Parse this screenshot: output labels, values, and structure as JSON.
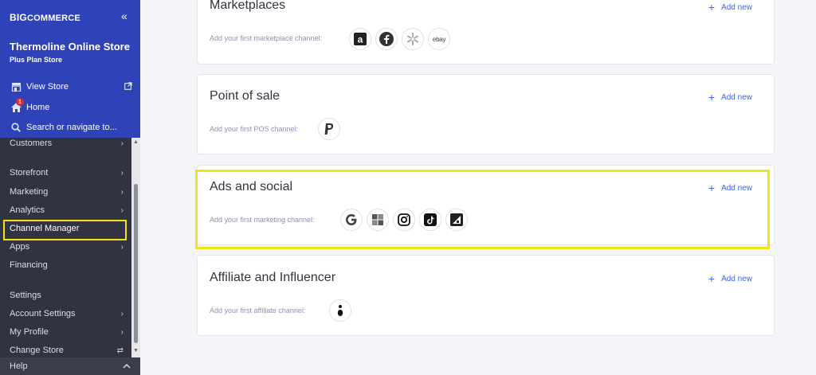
{
  "sidebar": {
    "brand_prefix": "BIG",
    "brand_suffix": "COMMERCE",
    "collapse": "«",
    "store_name": "Thermoline Online Store",
    "store_plan": "Plus Plan Store",
    "view_store": "View Store",
    "home": "Home",
    "home_badge": "1",
    "search": "Search or navigate to...",
    "items": [
      {
        "label": "Customers"
      },
      {
        "label": "Storefront"
      },
      {
        "label": "Marketing"
      },
      {
        "label": "Analytics"
      },
      {
        "label": "Channel Manager"
      },
      {
        "label": "Apps"
      },
      {
        "label": "Financing"
      },
      {
        "label": "Settings"
      },
      {
        "label": "Account Settings"
      },
      {
        "label": "My Profile"
      },
      {
        "label": "Change Store"
      }
    ],
    "help": "Help"
  },
  "cards": [
    {
      "title": "Marketplaces",
      "add_new": "Add new",
      "prompt": "Add your first marketplace channel:",
      "icons": [
        "amazon-icon",
        "facebook-icon",
        "walmart-icon",
        "ebay-icon"
      ]
    },
    {
      "title": "Point of sale",
      "add_new": "Add new",
      "prompt": "Add your first POS channel:",
      "icons": [
        "paypal-icon"
      ]
    },
    {
      "title": "Ads and social",
      "add_new": "Add new",
      "prompt": "Add your first marketing channel:",
      "icons": [
        "google-icon",
        "microsoft-icon",
        "instagram-icon",
        "tiktok-icon",
        "bigcommerce-icon"
      ]
    },
    {
      "title": "Affiliate and Influencer",
      "add_new": "Add new",
      "prompt": "Add your first affiliate channel:",
      "icons": [
        "affiliate-icon"
      ]
    }
  ],
  "ebay_text": "ebay",
  "colors": {
    "sidebar_top": "#2f43b8",
    "sidebar_bg": "#313440",
    "accent": "#3c64f4",
    "highlight": "#f3e214",
    "badge": "#db2b2b"
  }
}
